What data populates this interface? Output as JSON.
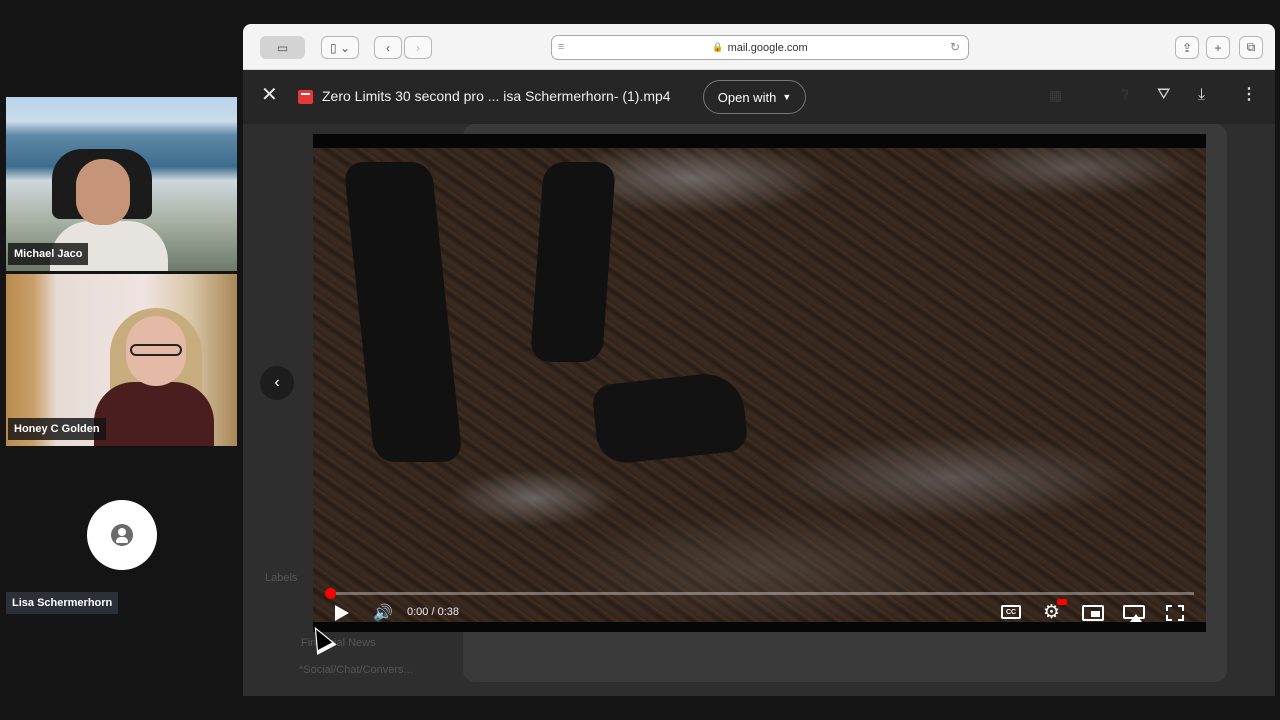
{
  "participants": [
    {
      "name": "Michael Jaco"
    },
    {
      "name": "Honey C Golden"
    },
    {
      "name": "Lisa Schermerhorn"
    }
  ],
  "browser": {
    "address": "mail.google.com"
  },
  "viewer": {
    "file_name": "Zero Limits 30 second pro ... isa Schermerhorn- (1).mp4",
    "open_with_label": "Open with"
  },
  "background": {
    "labels_heading": "Labels",
    "label_items": [
      "Financial News",
      "*Social/Chat/Convers..."
    ]
  },
  "video": {
    "time_display": "0:00 / 0:38",
    "progress_fraction": 0.0,
    "cc_label": "CC"
  },
  "icons": {
    "close": "close-icon",
    "download": "download-icon",
    "add_to_drive": "add-to-drive-icon",
    "more": "more-vert-icon",
    "settings": "gear-icon"
  },
  "colors": {
    "progress": "#ff0000",
    "file_icon": "#e53935"
  }
}
